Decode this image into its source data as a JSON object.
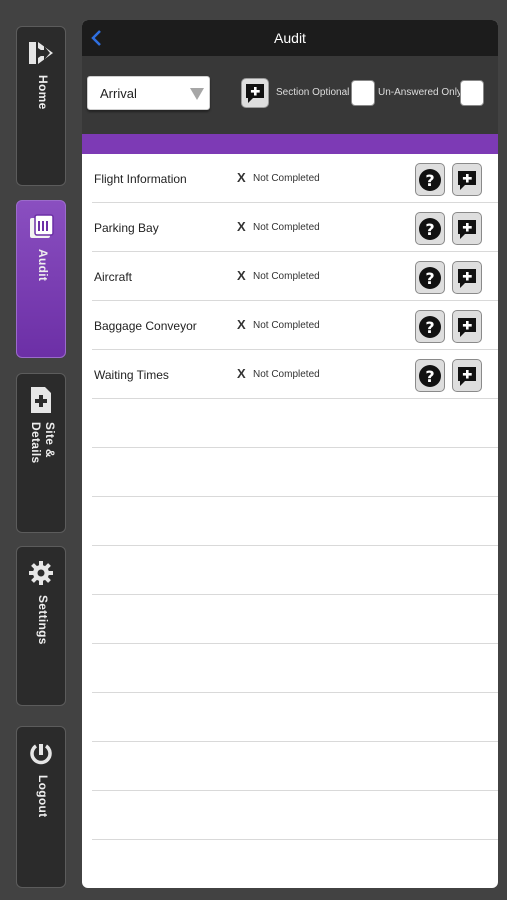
{
  "sidebar": {
    "items": [
      {
        "label": "Home",
        "icon": "home-arrow-icon",
        "active": false
      },
      {
        "label": "Audit",
        "icon": "audit-document-icon",
        "active": true
      },
      {
        "label": "Site &\nDetails",
        "icon": "site-details-icon",
        "active": false
      },
      {
        "label": "Settings",
        "icon": "gear-icon",
        "active": false
      },
      {
        "label": "Logout",
        "icon": "power-icon",
        "active": false
      }
    ]
  },
  "header": {
    "title": "Audit",
    "back_icon": "chevron-left-icon"
  },
  "toolbar": {
    "dropdown_value": "Arrival",
    "section_optional_label": "Section Optional",
    "unanswered_only_label": "Un-Answered Only"
  },
  "sections": [
    {
      "label": "Flight Information",
      "mark": "X",
      "status": "Not Completed"
    },
    {
      "label": "Parking Bay",
      "mark": "X",
      "status": "Not Completed"
    },
    {
      "label": "Aircraft",
      "mark": "X",
      "status": "Not Completed"
    },
    {
      "label": "Baggage Conveyor",
      "mark": "X",
      "status": "Not Completed"
    },
    {
      "label": "Waiting Times",
      "mark": "X",
      "status": "Not Completed"
    }
  ],
  "colors": {
    "accent": "#7d3ab5",
    "background": "#424242",
    "titlebar": "#1c1c1c",
    "back": "#2f6fe0"
  }
}
